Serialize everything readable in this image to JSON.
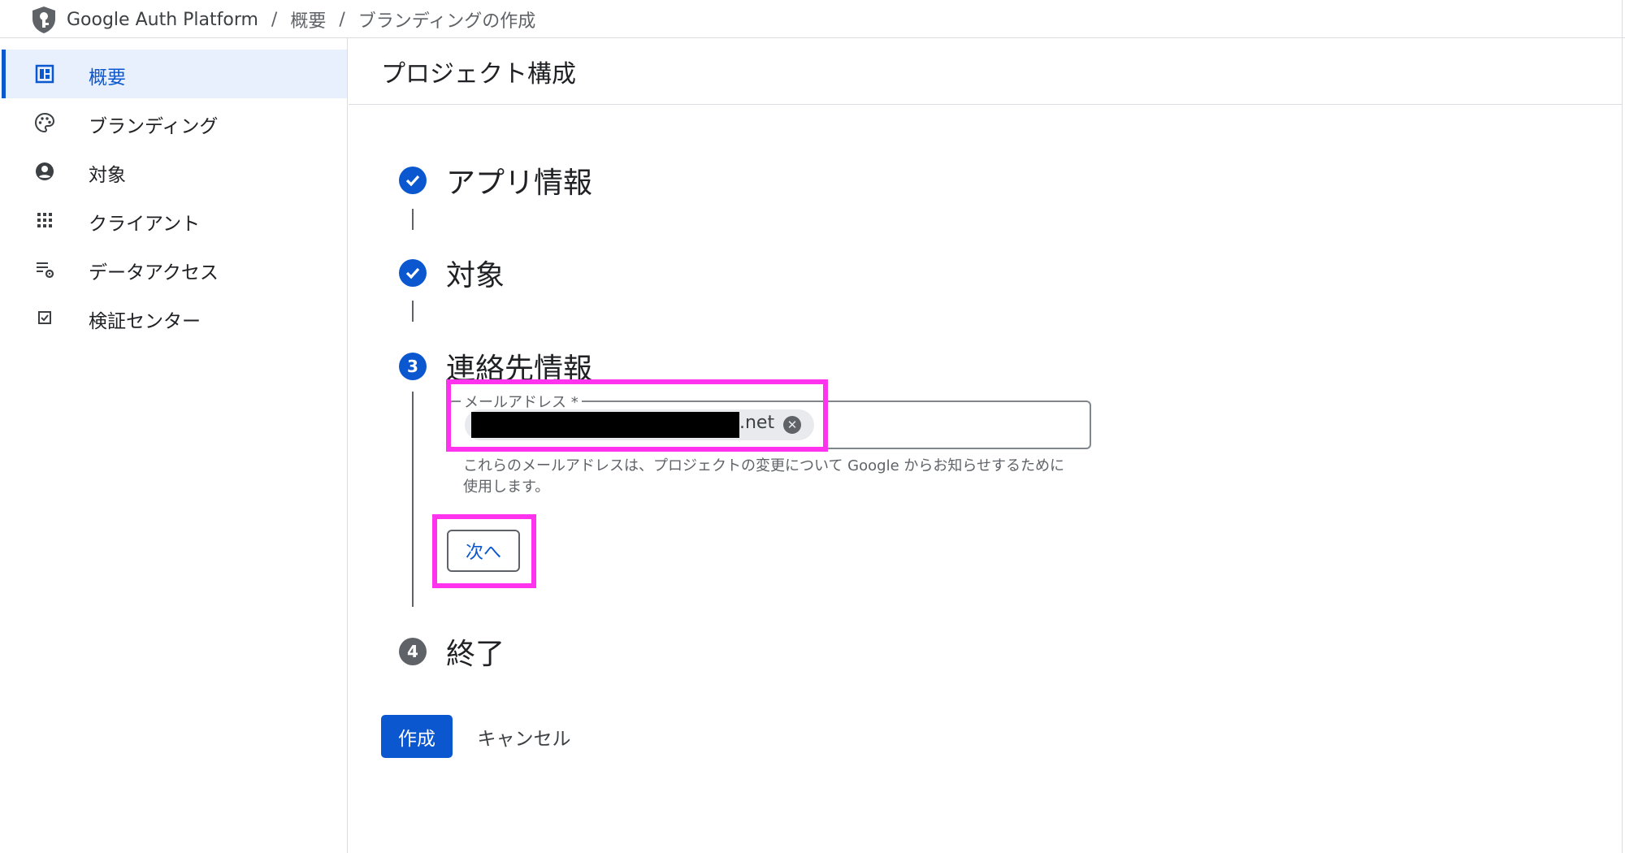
{
  "breadcrumb": {
    "app_name": "Google Auth Platform",
    "separator": "/",
    "items": [
      "概要",
      "ブランディングの作成"
    ]
  },
  "sidebar": {
    "items": [
      {
        "label": "概要",
        "icon": "dashboard-icon",
        "active": true
      },
      {
        "label": "ブランディング",
        "icon": "palette-icon",
        "active": false
      },
      {
        "label": "対象",
        "icon": "account-circle-icon",
        "active": false
      },
      {
        "label": "クライアント",
        "icon": "apps-grid-icon",
        "active": false
      },
      {
        "label": "データアクセス",
        "icon": "list-settings-icon",
        "active": false
      },
      {
        "label": "検証センター",
        "icon": "check-box-icon",
        "active": false
      }
    ]
  },
  "page": {
    "title": "プロジェクト構成"
  },
  "steps": [
    {
      "number": "1",
      "title": "アプリ情報",
      "status": "done"
    },
    {
      "number": "2",
      "title": "対象",
      "status": "done"
    },
    {
      "number": "3",
      "title": "連絡先情報",
      "status": "current"
    },
    {
      "number": "4",
      "title": "終了",
      "status": "pending"
    }
  ],
  "contact": {
    "email_label": "メールアドレス *",
    "email_chip_suffix": ".net",
    "hint": "これらのメールアドレスは、プロジェクトの変更について Google からお知らせするために使用します。",
    "next_label": "次へ"
  },
  "actions": {
    "create_label": "作成",
    "cancel_label": "キャンセル"
  },
  "colors": {
    "accent": "#0b57d0",
    "active_bg": "#e8f0fe",
    "highlight": "#ff33ee",
    "pending_step": "#5f6368"
  }
}
